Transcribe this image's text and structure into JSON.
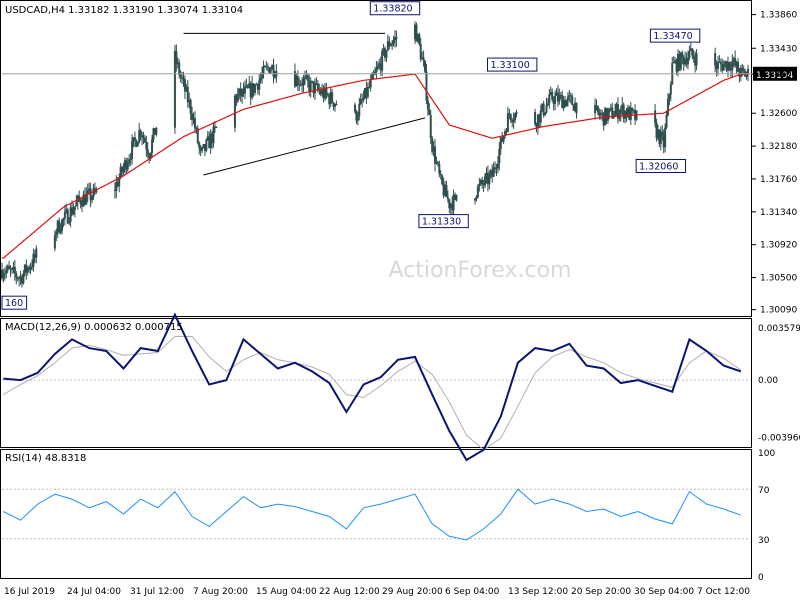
{
  "header": {
    "symbol_title": "USDCAD,H4  1.33182 1.33190 1.33074 1.33104"
  },
  "watermark": "ActionForex.com",
  "colors": {
    "candle": "#2f4f4f",
    "ma": "#dd1111",
    "macd_main": "#0b1470",
    "macd_signal": "#b0b0b0",
    "rsi": "#1e90ff",
    "label_border": "#0b1470",
    "price_tag_bg": "#000000",
    "price_tag_text": "#ffffff",
    "grid": "#c0c0c0",
    "trendline": "#000000"
  },
  "chart_data": [
    {
      "type": "candlestick",
      "name": "price",
      "price_range": [
        1.3006,
        1.3397
      ],
      "y_ticks": [
        "1.33860",
        "1.33430",
        "1.33100",
        "1.32600",
        "1.32180",
        "1.31760",
        "1.31340",
        "1.30920",
        "1.30500",
        "1.30090"
      ],
      "y_tick_values": [
        1.3386,
        1.3343,
        1.331,
        1.326,
        1.3218,
        1.3176,
        1.3134,
        1.3092,
        1.305,
        1.3009
      ],
      "current_price": "1.33104",
      "annotations": [
        {
          "text": "1.33820",
          "x_time": "2019-08-30 16:00",
          "y": 1.3382
        },
        {
          "text": "1.31330",
          "x_time": "2019-09-05 08:00",
          "y": 1.3133
        },
        {
          "text": "1.33100",
          "x_time": "2019-09-13 08:00",
          "y": 1.331
        },
        {
          "text": "1.33470",
          "x_time": "2019-10-02 08:00",
          "y": 1.3347
        },
        {
          "text": "1.32060",
          "x_time": "2019-09-30 16:00",
          "y": 1.3206
        },
        {
          "text": "160",
          "x_time": "2019-07-16 00:00",
          "y": 1.3016
        }
      ],
      "trendlines": [
        {
          "from_time": "2019-08-06 00:00",
          "from_y": 1.3362,
          "to_time": "2019-08-29 12:00",
          "to_y": 1.3362
        },
        {
          "from_time": "2019-08-08 08:00",
          "from_y": 1.3181,
          "to_time": "2019-09-03 04:00",
          "to_y": 1.3254
        }
      ],
      "ma_levels": [
        [
          "2019-07-16",
          1.3075
        ],
        [
          "2019-07-23",
          1.314
        ],
        [
          "2019-07-30",
          1.318
        ],
        [
          "2019-08-06",
          1.323
        ],
        [
          "2019-08-13",
          1.3265
        ],
        [
          "2019-08-20",
          1.3286
        ],
        [
          "2019-08-27",
          1.3302
        ],
        [
          "2019-09-02",
          1.331
        ],
        [
          "2019-09-06",
          1.3245
        ],
        [
          "2019-09-11",
          1.3228
        ],
        [
          "2019-09-17",
          1.3243
        ],
        [
          "2019-09-24",
          1.3255
        ],
        [
          "2019-10-01",
          1.326
        ],
        [
          "2019-10-08",
          1.3302
        ],
        [
          "2019-10-10",
          1.331
        ]
      ],
      "close_levels": [
        [
          "2019-07-16",
          1.306
        ],
        [
          "2019-07-18",
          1.305
        ],
        [
          "2019-07-22",
          1.311
        ],
        [
          "2019-07-25",
          1.315
        ],
        [
          "2019-07-29",
          1.3165
        ],
        [
          "2019-08-01",
          1.324
        ],
        [
          "2019-08-02",
          1.321
        ],
        [
          "2019-08-05",
          1.333
        ],
        [
          "2019-08-07",
          1.326
        ],
        [
          "2019-08-08",
          1.3205
        ],
        [
          "2019-08-12",
          1.328
        ],
        [
          "2019-08-14",
          1.329
        ],
        [
          "2019-08-16",
          1.332
        ],
        [
          "2019-08-20",
          1.33
        ],
        [
          "2019-08-23",
          1.328
        ],
        [
          "2019-08-26",
          1.3255
        ],
        [
          "2019-08-28",
          1.33
        ],
        [
          "2019-08-30",
          1.335
        ],
        [
          "2019-09-02",
          1.337
        ],
        [
          "2019-09-03",
          1.332
        ],
        [
          "2019-09-04",
          1.322
        ],
        [
          "2019-09-05",
          1.317
        ],
        [
          "2019-09-06",
          1.3145
        ],
        [
          "2019-09-09",
          1.316
        ],
        [
          "2019-09-11",
          1.318
        ],
        [
          "2019-09-13",
          1.326
        ],
        [
          "2019-09-16",
          1.325
        ],
        [
          "2019-09-18",
          1.328
        ],
        [
          "2019-09-20",
          1.3275
        ],
        [
          "2019-09-24",
          1.3255
        ],
        [
          "2019-09-26",
          1.3265
        ],
        [
          "2019-09-30",
          1.324
        ],
        [
          "2019-10-01",
          1.322
        ],
        [
          "2019-10-02",
          1.332
        ],
        [
          "2019-10-04",
          1.3335
        ],
        [
          "2019-10-07",
          1.332
        ],
        [
          "2019-10-09",
          1.3325
        ],
        [
          "2019-10-10",
          1.331
        ]
      ],
      "x_tick_labels": [
        "16 Jul 2019",
        "24 Jul 04:00",
        "31 Jul 12:00",
        "7 Aug 20:00",
        "15 Aug 04:00",
        "22 Aug 12:00",
        "29 Aug 20:00",
        "6 Sep 04:00",
        "13 Sep 12:00",
        "20 Sep 20:00",
        "30 Sep 04:00",
        "7 Oct 12:00"
      ]
    },
    {
      "type": "line",
      "name": "macd",
      "title": "MACD(12,26,9) 0.000632 0.000715",
      "y_ticks": [
        "0.003579",
        "0.00",
        "-0.003966"
      ],
      "y_tick_values": [
        0.003579,
        0.0,
        -0.003966
      ],
      "y_range": [
        -0.0044,
        0.004
      ],
      "series": [
        {
          "values": [
            [
              "2019-07-16",
              0.0001
            ],
            [
              "2019-07-18",
              0.0
            ],
            [
              "2019-07-20",
              0.0005
            ],
            [
              "2019-07-22",
              0.0018
            ],
            [
              "2019-07-24",
              0.0028
            ],
            [
              "2019-07-26",
              0.0022
            ],
            [
              "2019-07-28",
              0.002
            ],
            [
              "2019-07-30",
              0.0008
            ],
            [
              "2019-08-01",
              0.0022
            ],
            [
              "2019-08-03",
              0.002
            ],
            [
              "2019-08-05",
              0.0045
            ],
            [
              "2019-08-07",
              0.002
            ],
            [
              "2019-08-09",
              -0.0003
            ],
            [
              "2019-08-11",
              0.0
            ],
            [
              "2019-08-13",
              0.0028
            ],
            [
              "2019-08-15",
              0.0018
            ],
            [
              "2019-08-17",
              0.0008
            ],
            [
              "2019-08-19",
              0.0012
            ],
            [
              "2019-08-21",
              0.0006
            ],
            [
              "2019-08-23",
              -0.0002
            ],
            [
              "2019-08-25",
              -0.0022
            ],
            [
              "2019-08-27",
              -0.0003
            ],
            [
              "2019-08-29",
              0.0002
            ],
            [
              "2019-08-31",
              0.0014
            ],
            [
              "2019-09-02",
              0.0016
            ],
            [
              "2019-09-04",
              -0.001
            ],
            [
              "2019-09-06",
              -0.0035
            ],
            [
              "2019-09-08",
              -0.0055
            ],
            [
              "2019-09-10",
              -0.0048
            ],
            [
              "2019-09-12",
              -0.0025
            ],
            [
              "2019-09-14",
              0.0012
            ],
            [
              "2019-09-16",
              0.0022
            ],
            [
              "2019-09-18",
              0.002
            ],
            [
              "2019-09-20",
              0.0025
            ],
            [
              "2019-09-22",
              0.001
            ],
            [
              "2019-09-24",
              0.0008
            ],
            [
              "2019-09-26",
              -0.0002
            ],
            [
              "2019-09-28",
              0.0
            ],
            [
              "2019-09-30",
              -0.0004
            ],
            [
              "2019-10-02",
              -0.0008
            ],
            [
              "2019-10-04",
              0.0028
            ],
            [
              "2019-10-06",
              0.002
            ],
            [
              "2019-10-08",
              0.001
            ],
            [
              "2019-10-10",
              0.0006
            ]
          ]
        },
        {
          "values": [
            [
              "2019-07-16",
              -0.001
            ],
            [
              "2019-07-18",
              -0.0003
            ],
            [
              "2019-07-20",
              0.0003
            ],
            [
              "2019-07-22",
              0.0012
            ],
            [
              "2019-07-24",
              0.0022
            ],
            [
              "2019-07-26",
              0.0024
            ],
            [
              "2019-07-28",
              0.0021
            ],
            [
              "2019-07-30",
              0.0017
            ],
            [
              "2019-08-01",
              0.0018
            ],
            [
              "2019-08-03",
              0.0019
            ],
            [
              "2019-08-05",
              0.003
            ],
            [
              "2019-08-07",
              0.003
            ],
            [
              "2019-08-09",
              0.0016
            ],
            [
              "2019-08-11",
              0.0006
            ],
            [
              "2019-08-13",
              0.0014
            ],
            [
              "2019-08-15",
              0.0019
            ],
            [
              "2019-08-17",
              0.0014
            ],
            [
              "2019-08-19",
              0.0012
            ],
            [
              "2019-08-21",
              0.0009
            ],
            [
              "2019-08-23",
              0.0004
            ],
            [
              "2019-08-25",
              -0.001
            ],
            [
              "2019-08-27",
              -0.0012
            ],
            [
              "2019-08-29",
              -0.0004
            ],
            [
              "2019-08-31",
              0.0006
            ],
            [
              "2019-09-02",
              0.0013
            ],
            [
              "2019-09-04",
              0.0004
            ],
            [
              "2019-09-06",
              -0.0015
            ],
            [
              "2019-09-08",
              -0.0038
            ],
            [
              "2019-09-10",
              -0.0048
            ],
            [
              "2019-09-12",
              -0.004
            ],
            [
              "2019-09-14",
              -0.0018
            ],
            [
              "2019-09-16",
              0.0005
            ],
            [
              "2019-09-18",
              0.0016
            ],
            [
              "2019-09-20",
              0.0021
            ],
            [
              "2019-09-22",
              0.0016
            ],
            [
              "2019-09-24",
              0.0012
            ],
            [
              "2019-09-26",
              0.0005
            ],
            [
              "2019-09-28",
              0.0001
            ],
            [
              "2019-09-30",
              -0.0002
            ],
            [
              "2019-10-02",
              -0.0005
            ],
            [
              "2019-10-04",
              0.0012
            ],
            [
              "2019-10-06",
              0.002
            ],
            [
              "2019-10-08",
              0.0015
            ],
            [
              "2019-10-10",
              0.0007
            ]
          ]
        }
      ]
    },
    {
      "type": "line",
      "name": "rsi",
      "title": "RSI(14) 48.8318",
      "y_ticks": [
        "100",
        "70",
        "30",
        "0"
      ],
      "y_tick_values": [
        100,
        70,
        30,
        0
      ],
      "y_range": [
        0,
        100
      ],
      "reference_lines": [
        70,
        30
      ],
      "series": [
        {
          "values": [
            [
              "2019-07-16",
              52
            ],
            [
              "2019-07-18",
              45
            ],
            [
              "2019-07-20",
              58
            ],
            [
              "2019-07-22",
              66
            ],
            [
              "2019-07-24",
              62
            ],
            [
              "2019-07-26",
              55
            ],
            [
              "2019-07-28",
              60
            ],
            [
              "2019-07-30",
              50
            ],
            [
              "2019-08-01",
              62
            ],
            [
              "2019-08-03",
              55
            ],
            [
              "2019-08-05",
              68
            ],
            [
              "2019-08-07",
              48
            ],
            [
              "2019-08-09",
              40
            ],
            [
              "2019-08-11",
              52
            ],
            [
              "2019-08-13",
              64
            ],
            [
              "2019-08-15",
              55
            ],
            [
              "2019-08-17",
              58
            ],
            [
              "2019-08-19",
              56
            ],
            [
              "2019-08-21",
              52
            ],
            [
              "2019-08-23",
              48
            ],
            [
              "2019-08-25",
              38
            ],
            [
              "2019-08-27",
              55
            ],
            [
              "2019-08-29",
              58
            ],
            [
              "2019-08-31",
              62
            ],
            [
              "2019-09-02",
              66
            ],
            [
              "2019-09-04",
              42
            ],
            [
              "2019-09-06",
              32
            ],
            [
              "2019-09-08",
              29
            ],
            [
              "2019-09-10",
              38
            ],
            [
              "2019-09-12",
              50
            ],
            [
              "2019-09-14",
              70
            ],
            [
              "2019-09-16",
              58
            ],
            [
              "2019-09-18",
              62
            ],
            [
              "2019-09-20",
              58
            ],
            [
              "2019-09-22",
              52
            ],
            [
              "2019-09-24",
              54
            ],
            [
              "2019-09-26",
              48
            ],
            [
              "2019-09-28",
              52
            ],
            [
              "2019-09-30",
              46
            ],
            [
              "2019-10-02",
              42
            ],
            [
              "2019-10-04",
              68
            ],
            [
              "2019-10-06",
              58
            ],
            [
              "2019-10-08",
              54
            ],
            [
              "2019-10-10",
              49
            ]
          ]
        }
      ]
    }
  ]
}
